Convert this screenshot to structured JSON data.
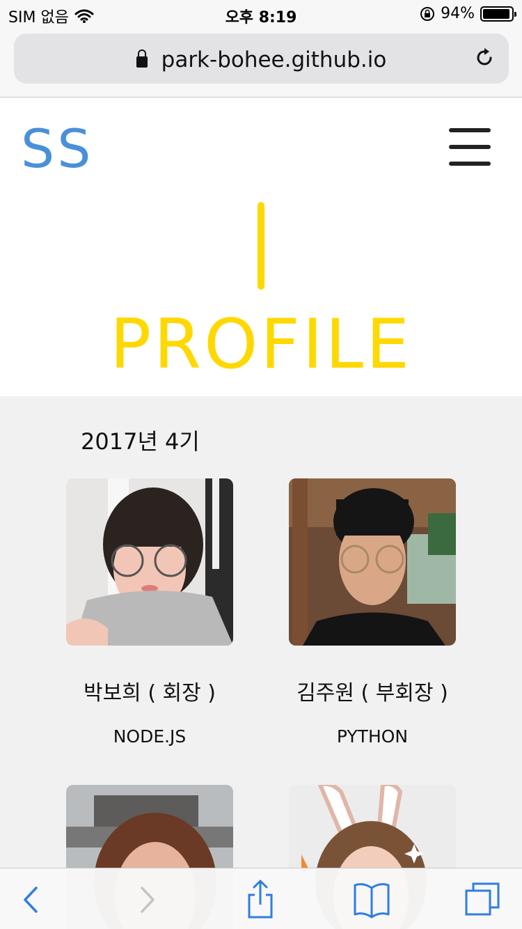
{
  "status_bar": {
    "carrier": "SIM 없음",
    "time": "오후 8:19",
    "battery_percent": "94%",
    "battery_level": 0.94
  },
  "browser": {
    "url": "park-bohee.github.io",
    "icons": [
      "lock-icon",
      "reload-icon",
      "back-icon",
      "forward-icon",
      "share-icon",
      "bookmarks-icon",
      "tabs-icon"
    ]
  },
  "header": {
    "logo": "SS",
    "menu_icon": "hamburger-menu-icon"
  },
  "hero": {
    "title": "PROFILE",
    "accent_color": "#ffd800"
  },
  "profiles": {
    "section_title": "2017년 4기",
    "members": [
      {
        "name": "박보희 ( 회장 )",
        "skill": "NODE.JS"
      },
      {
        "name": "김주원 ( 부회장 )",
        "skill": "PYTHON"
      },
      {
        "name": "",
        "skill": ""
      },
      {
        "name": "",
        "skill": ""
      }
    ]
  },
  "colors": {
    "logo": "#4a90d9",
    "accent": "#ffd800",
    "section_bg": "#f1f1f1",
    "toolbar_icon": "#2f7de1"
  }
}
